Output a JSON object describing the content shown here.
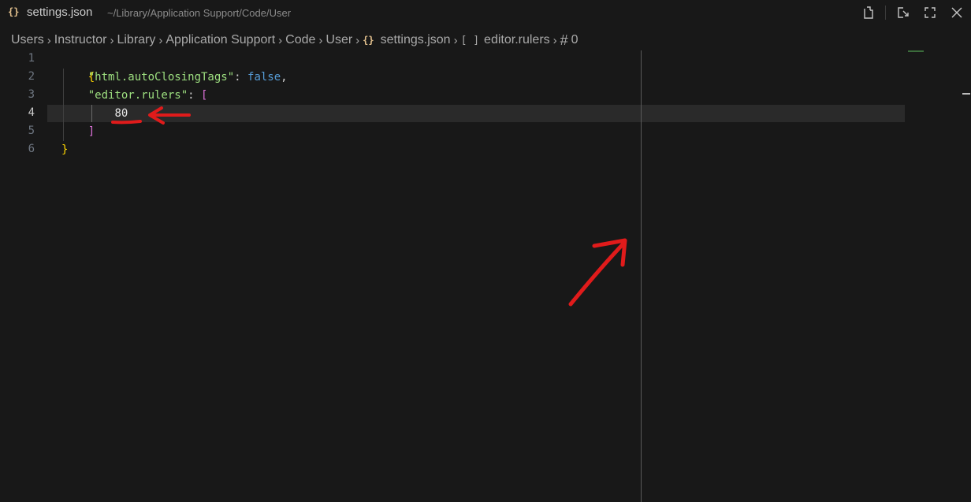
{
  "titlebar": {
    "file_icon": "{}",
    "file_name": "settings.json",
    "file_path": "~/Library/Application Support/Code/User",
    "actions": [
      "open-changes-icon",
      "open-preview-icon",
      "maximize-icon",
      "close-icon"
    ]
  },
  "breadcrumb": {
    "segments": [
      "Users",
      "Instructor",
      "Library",
      "Application Support",
      "Code",
      "User"
    ],
    "file_icon": "{}",
    "file": "settings.json",
    "array_icon": "[ ]",
    "property": "editor.rulers",
    "number_icon": "#",
    "element": "0"
  },
  "editor": {
    "line_numbers": [
      "1",
      "2",
      "3",
      "4",
      "5",
      "6"
    ],
    "active_line": "4",
    "ruler_column": 80,
    "lines": {
      "l1": {
        "open": "{"
      },
      "l2": {
        "key": "\"html.autoClosingTags\"",
        "colon": ": ",
        "value": "false",
        "comma": ","
      },
      "l3": {
        "key": "\"editor.rulers\"",
        "colon": ": ",
        "value": "["
      },
      "l4": {
        "value": "80"
      },
      "l5": {
        "close": "]"
      },
      "l6": {
        "close": "}"
      }
    }
  },
  "annotation_colors": {
    "red_marker": "#e01b1b"
  }
}
